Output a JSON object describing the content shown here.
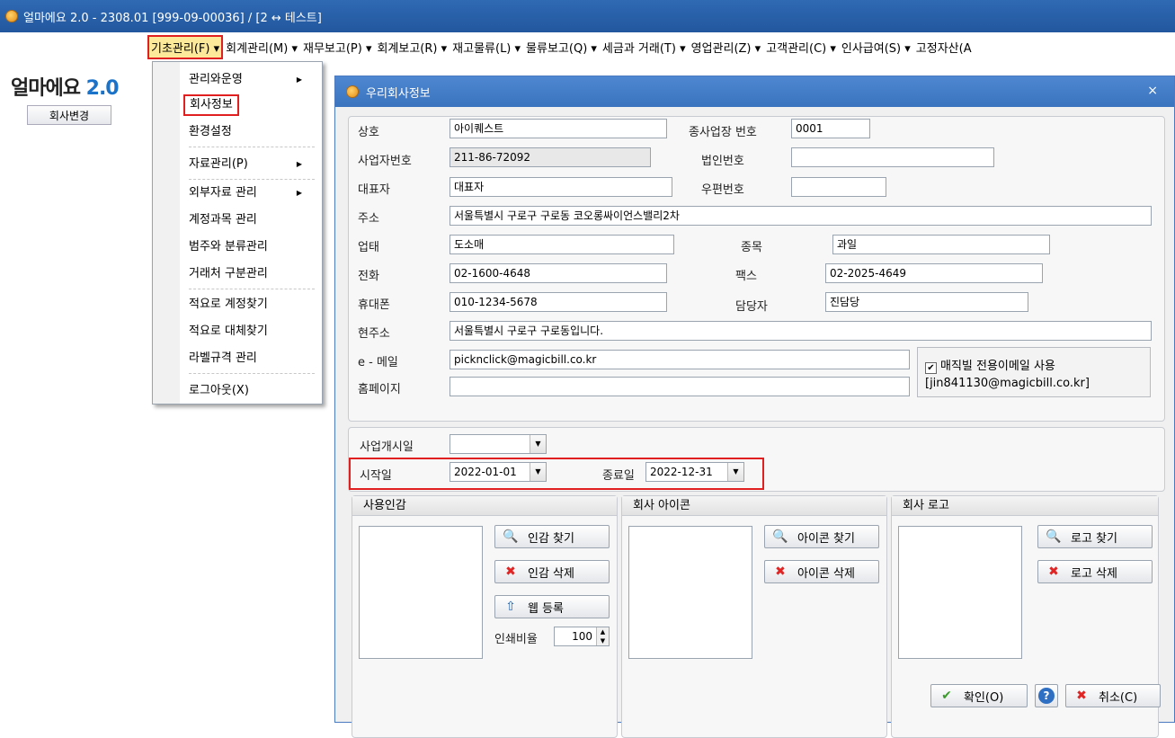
{
  "window": {
    "title": "얼마에요 2.0 - 2308.01 [999-09-00036] / [2 ↔ 테스트]"
  },
  "menubar": {
    "items": [
      "기초관리(F) ▾",
      "회계관리(M) ▾",
      "재무보고(P) ▾",
      "회계보고(R) ▾",
      "재고물류(L) ▾",
      "물류보고(Q) ▾",
      "세금과 거래(T) ▾",
      "영업관리(Z) ▾",
      "고객관리(C) ▾",
      "인사급여(S) ▾",
      "고정자산(A"
    ]
  },
  "left": {
    "logo_text": "얼마에요",
    "logo_version": "2.0",
    "change_company_label": "회사변경"
  },
  "dropdown": {
    "items": [
      "관리와운영",
      "회사정보",
      "환경설정",
      "자료관리(P)",
      "외부자료 관리",
      "계정과목 관리",
      "범주와 분류관리",
      "거래처 구분관리",
      "적요로 계정찾기",
      "적요로 대체찾기",
      "라벨규격 관리",
      "로그아웃(X)"
    ],
    "submenu_arrow": "▶"
  },
  "dialog": {
    "title": "우리회사정보",
    "close": "×",
    "fields": {
      "name_label": "상호",
      "name_value": "아이퀘스트",
      "branch_label": "종사업장 번호",
      "branch_value": "0001",
      "bizno_label": "사업자번호",
      "bizno_value": "211-86-72092",
      "corpno_label": "법인번호",
      "corpno_value": "",
      "ceo_label": "대표자",
      "ceo_value": "대표자",
      "zip_label": "우편번호",
      "zip_value": "",
      "addr_label": "주소",
      "addr_value": "서울특별시 구로구 구로동 코오롱싸이언스밸리2차",
      "biztype_label": "업태",
      "biztype_value": "도소매",
      "item_label": "종목",
      "item_value": "과일",
      "tel_label": "전화",
      "tel_value": "02-1600-4648",
      "fax_label": "팩스",
      "fax_value": "02-2025-4649",
      "mobile_label": "휴대폰",
      "mobile_value": "010-1234-5678",
      "manager_label": "담당자",
      "manager_value": "진담당",
      "curaddr_label": "현주소",
      "curaddr_value": "서울특별시 구로구 구로동입니다.",
      "email_label": "e - 메일",
      "email_value": "picknclick@magicbill.co.kr",
      "home_label": "홈페이지",
      "home_value": "",
      "magic_check_label": "매직빌 전용이메일 사용",
      "magic_check_mark": "✔",
      "magic_email": "[jin841130@magicbill.co.kr]"
    },
    "dates": {
      "open_label": "사업개시일",
      "open_value": "",
      "start_label": "시작일",
      "start_value": "2022-01-01",
      "end_label": "종료일",
      "end_value": "2022-12-31",
      "drop_arrow": "▼"
    },
    "seal": {
      "header": "사용인감",
      "find": "인감 찾기",
      "delete": "인감 삭제",
      "web": "웹 등록",
      "ratio_label": "인쇄비율",
      "ratio_value": "100"
    },
    "icon": {
      "header": "회사 아이콘",
      "find": "아이콘 찾기",
      "delete": "아이콘 삭제"
    },
    "logo": {
      "header": "회사 로고",
      "find": "로고 찾기",
      "delete": "로고 삭제"
    },
    "buttons": {
      "ok": "확인(O)",
      "help": "?",
      "cancel": "취소(C)"
    }
  }
}
